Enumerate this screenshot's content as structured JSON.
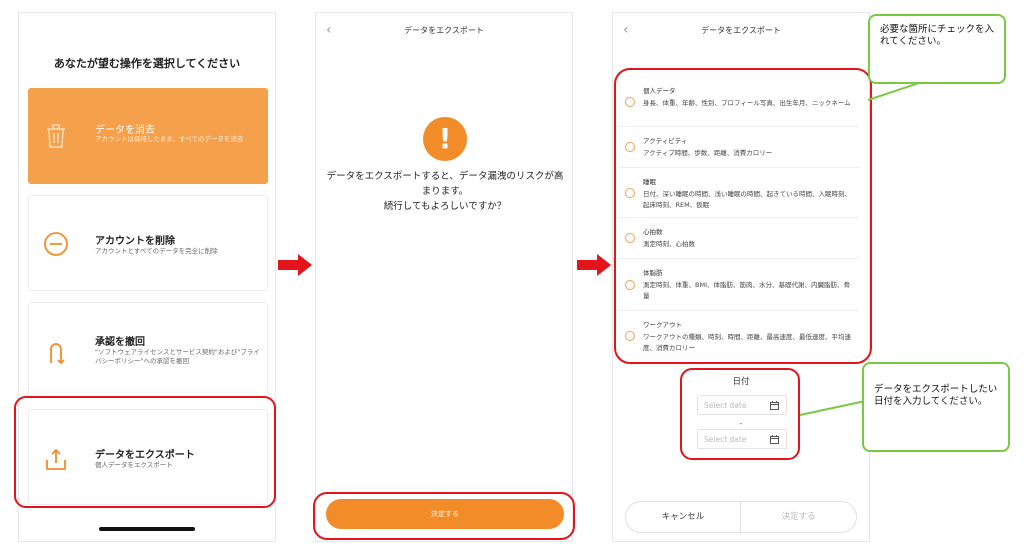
{
  "screen1": {
    "title": "あなたが望む操作を選択してください",
    "cards": [
      {
        "title": "データを消去",
        "desc": "アカウントは保持したまま、すべてのデータを消去",
        "icon": "trash-icon"
      },
      {
        "title": "アカウントを削除",
        "desc": "アカウントとすべてのデータを完全に削除",
        "icon": "minus-circle-icon"
      },
      {
        "title": "承認を撤回",
        "desc": "\"ソフトウェアライセンスとサービス契約\"および\"プライバシーポリシー\"への承認を撤回",
        "icon": "undo-arrow-icon"
      },
      {
        "title": "データをエクスポート",
        "desc": "個人データをエクスポート",
        "icon": "export-icon"
      }
    ]
  },
  "screen2": {
    "header": "データをエクスポート",
    "message_line1": "データをエクスポートすると、データ漏洩のリスクが高まります。",
    "message_line2": "続行してもよろしいですか？",
    "confirm": "決定する"
  },
  "screen3": {
    "header": "データをエクスポート",
    "items": [
      {
        "title": "個人データ",
        "desc": "身長、体重、年齢、性別、プロフィール写真、出生年月、ニックネーム"
      },
      {
        "title": "アクティビティ",
        "desc": "アクティブ時間、歩数、距離、消費カロリー"
      },
      {
        "title": "睡眠",
        "desc": "日付、深い睡眠の時間、浅い睡眠の時間、起きている時間、入眠時刻、起床時刻、REM、仮眠"
      },
      {
        "title": "心拍数",
        "desc": "測定時刻、心拍数"
      },
      {
        "title": "体脂肪",
        "desc": "測定時刻、体重、BMI、体脂肪、筋肉、水分、基礎代謝、内臓脂肪、骨量"
      },
      {
        "title": "ワークアウト",
        "desc": "ワークアウトの種類、時刻、時間、距離、最高速度、最低速度、平均速度、消費カロリー"
      }
    ],
    "date_title": "日付",
    "date_placeholder": "Select date",
    "date_separator": "-",
    "cancel": "キャンセル",
    "confirm": "決定する"
  },
  "annotations": {
    "callout1": "必要な箇所にチェックを入れてください。",
    "callout2": "データをエクスポートしたい日付を入力してください。"
  },
  "colors": {
    "accent": "#f28c28",
    "highlight_red": "#e3141b",
    "callout_green": "#7ac943"
  }
}
